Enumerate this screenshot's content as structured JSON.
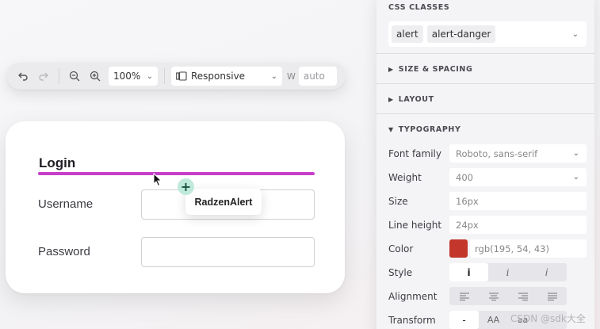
{
  "toolbar": {
    "undo_icon": "undo-icon",
    "redo_icon": "redo-icon",
    "zoom_out_icon": "zoom-out-icon",
    "zoom_in_icon": "zoom-in-icon",
    "zoom_value": "100%",
    "device_icon": "devices-icon",
    "device_value": "Responsive",
    "width_label": "W",
    "width_value": "auto"
  },
  "canvas": {
    "form_title": "Login",
    "username_label": "Username",
    "password_label": "Password",
    "drag_component": "RadzenAlert",
    "drop_line_color": "#c53fc9",
    "plus_icon": "+"
  },
  "panel": {
    "css_classes": {
      "title": "CSS CLASSES",
      "chips": [
        "alert",
        "alert-danger"
      ]
    },
    "size_spacing_title": "SIZE & SPACING",
    "layout_title": "LAYOUT",
    "typography_title": "TYPOGRAPHY",
    "typography": {
      "font_family_label": "Font family",
      "font_family_value": "Roboto, sans-serif",
      "weight_label": "Weight",
      "weight_value": "400",
      "size_label": "Size",
      "size_value": "16px",
      "line_height_label": "Line height",
      "line_height_value": "24px",
      "color_label": "Color",
      "color_swatch": "#c3362b",
      "color_value": "rgb(195, 54, 43)",
      "style_label": "Style",
      "style_options": [
        "i",
        "i",
        "i"
      ],
      "alignment_label": "Alignment",
      "alignment_icons": [
        "align-left-icon",
        "align-center-icon",
        "align-right-icon",
        "align-justify-icon"
      ],
      "transform_label": "Transform",
      "transform_options": [
        "-",
        "AA",
        "aa"
      ]
    }
  },
  "watermark": "CSDN @sdk大全"
}
